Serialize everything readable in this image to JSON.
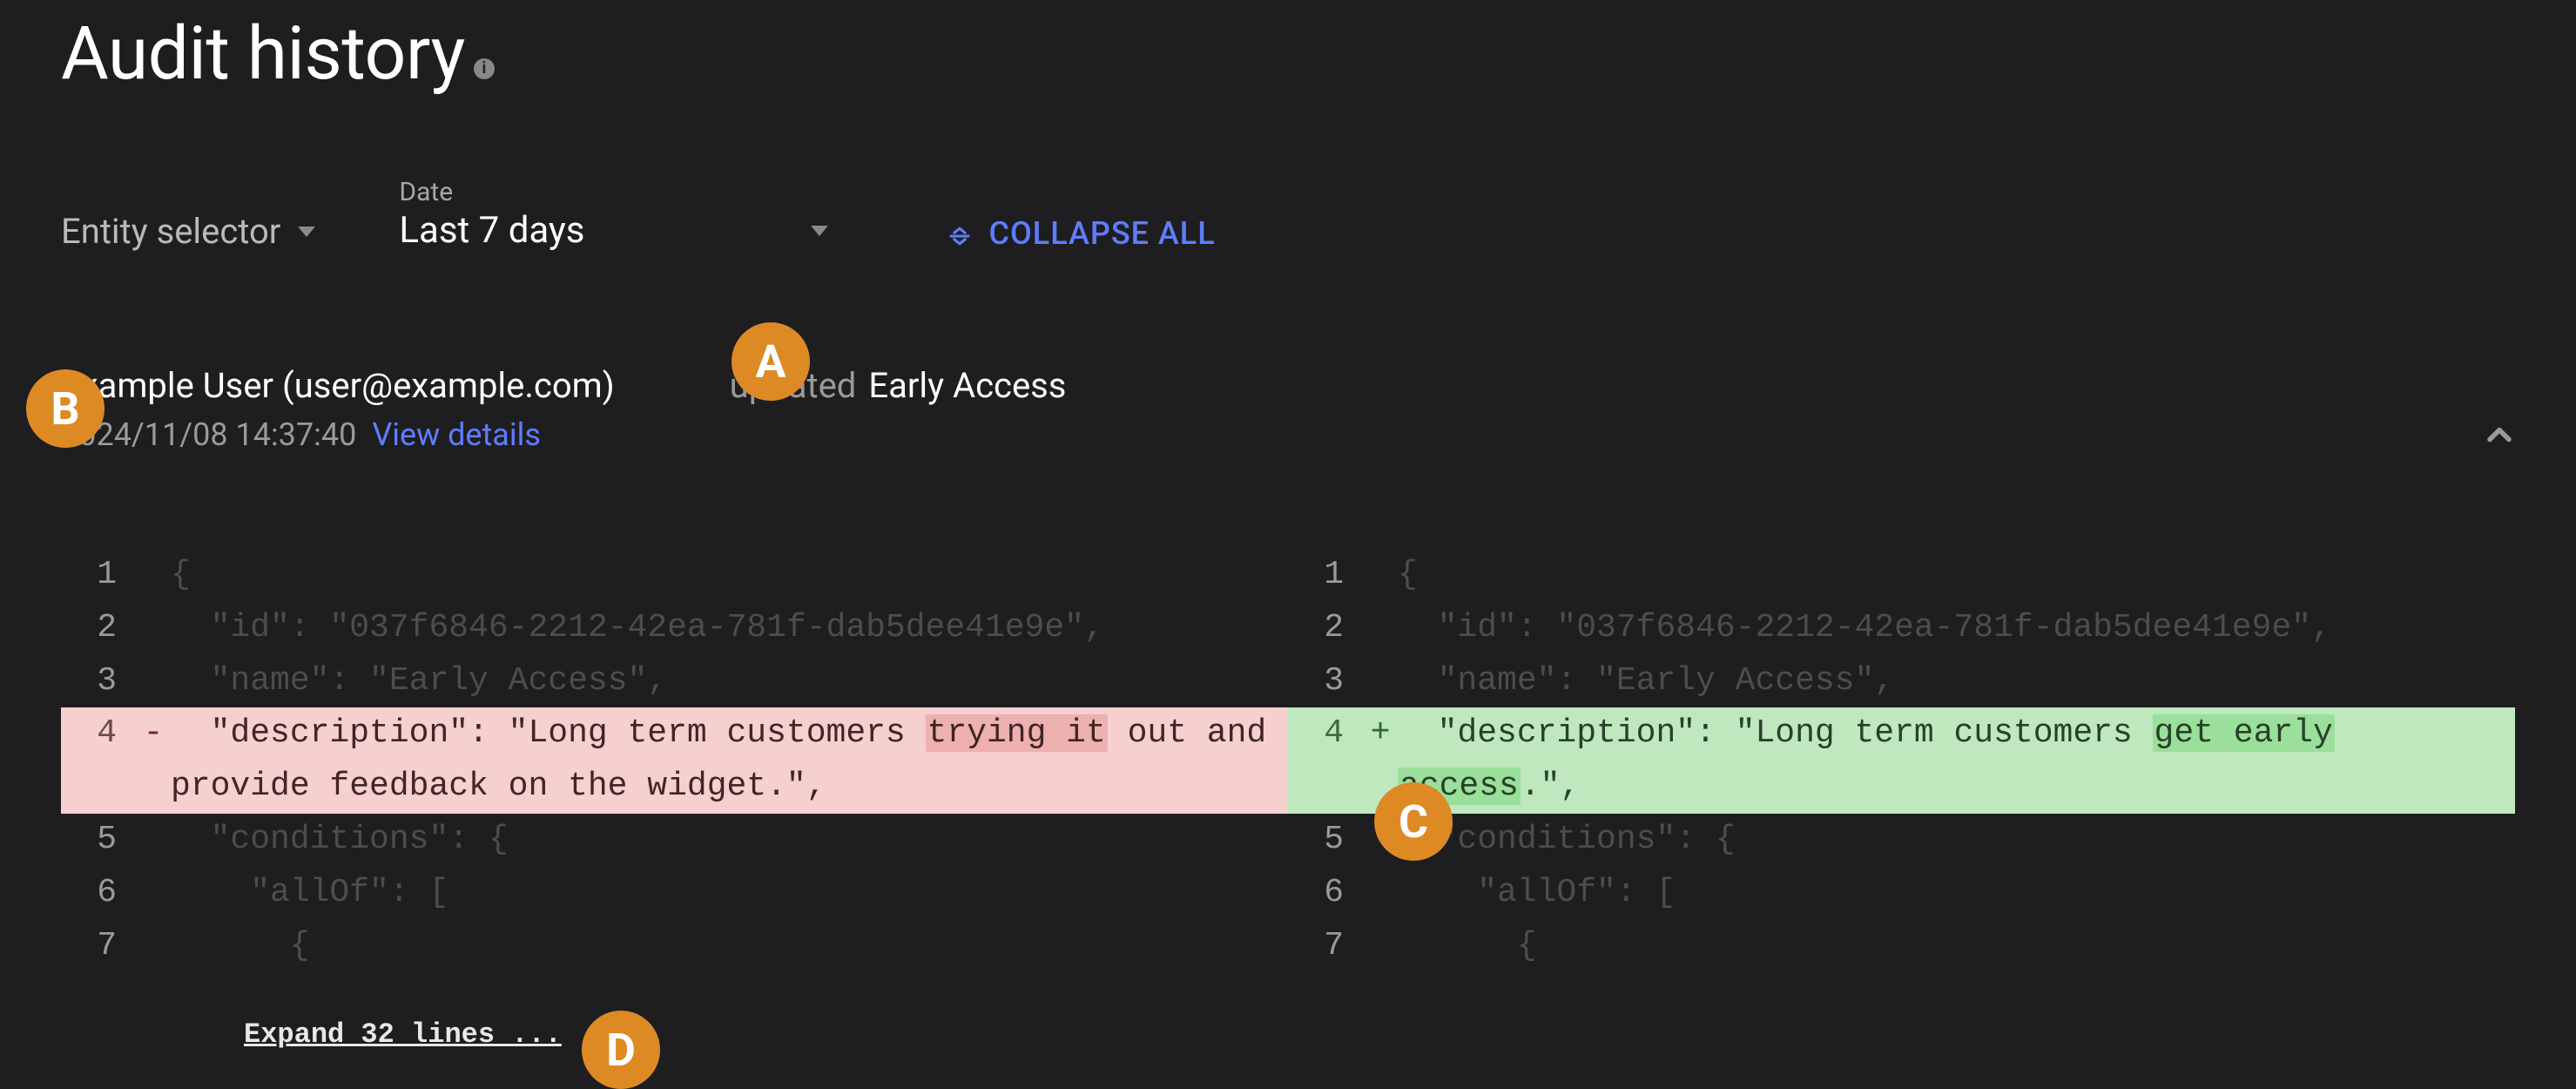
{
  "title": "Audit history",
  "filters": {
    "entity_label": "Entity selector",
    "date_label": "Date",
    "date_value": "Last 7 days",
    "collapse_all": "COLLAPSE ALL"
  },
  "entry": {
    "user": "Example User (user@example.com)",
    "action_verb": "updated",
    "target": "Early Access",
    "timestamp": "2024/11/08 14:37:40",
    "view_details": "View details"
  },
  "diff": {
    "left": [
      {
        "n": "1",
        "sign": "",
        "text": "{"
      },
      {
        "n": "2",
        "sign": "",
        "text": "  \"id\": \"037f6846-2212-42ea-781f-dab5dee41e9e\","
      },
      {
        "n": "3",
        "sign": "",
        "text": "  \"name\": \"Early Access\","
      },
      {
        "n": "4",
        "sign": "-",
        "kind": "removed",
        "segments": [
          {
            "t": "  \"description\": \"Long term customers "
          },
          {
            "t": "trying it",
            "hl": true
          },
          {
            "t": " out and provide feedback on the widget"
          },
          {
            "t": ".\"",
            "hl": false
          },
          {
            "t": ","
          }
        ]
      },
      {
        "n": "5",
        "sign": "",
        "text": "  \"conditions\": {"
      },
      {
        "n": "6",
        "sign": "",
        "text": "    \"allOf\": ["
      },
      {
        "n": "7",
        "sign": "",
        "text": "      {"
      }
    ],
    "right": [
      {
        "n": "1",
        "sign": "",
        "text": "{"
      },
      {
        "n": "2",
        "sign": "",
        "text": "  \"id\": \"037f6846-2212-42ea-781f-dab5dee41e9e\","
      },
      {
        "n": "3",
        "sign": "",
        "text": "  \"name\": \"Early Access\","
      },
      {
        "n": "4",
        "sign": "+",
        "kind": "added",
        "segments": [
          {
            "t": "  \"description\": \"Long term customers "
          },
          {
            "t": "get early",
            "hl": true
          },
          {
            "t": " "
          },
          {
            "t": "access",
            "hl": true
          },
          {
            "t": ".\","
          }
        ]
      },
      {
        "n": "5",
        "sign": "",
        "text": "  \"conditions\": {"
      },
      {
        "n": "6",
        "sign": "",
        "text": "    \"allOf\": ["
      },
      {
        "n": "7",
        "sign": "",
        "text": "      {"
      }
    ],
    "expand": "Expand 32 lines ..."
  },
  "badges": {
    "A": "A",
    "B": "B",
    "C": "C",
    "D": "D"
  }
}
